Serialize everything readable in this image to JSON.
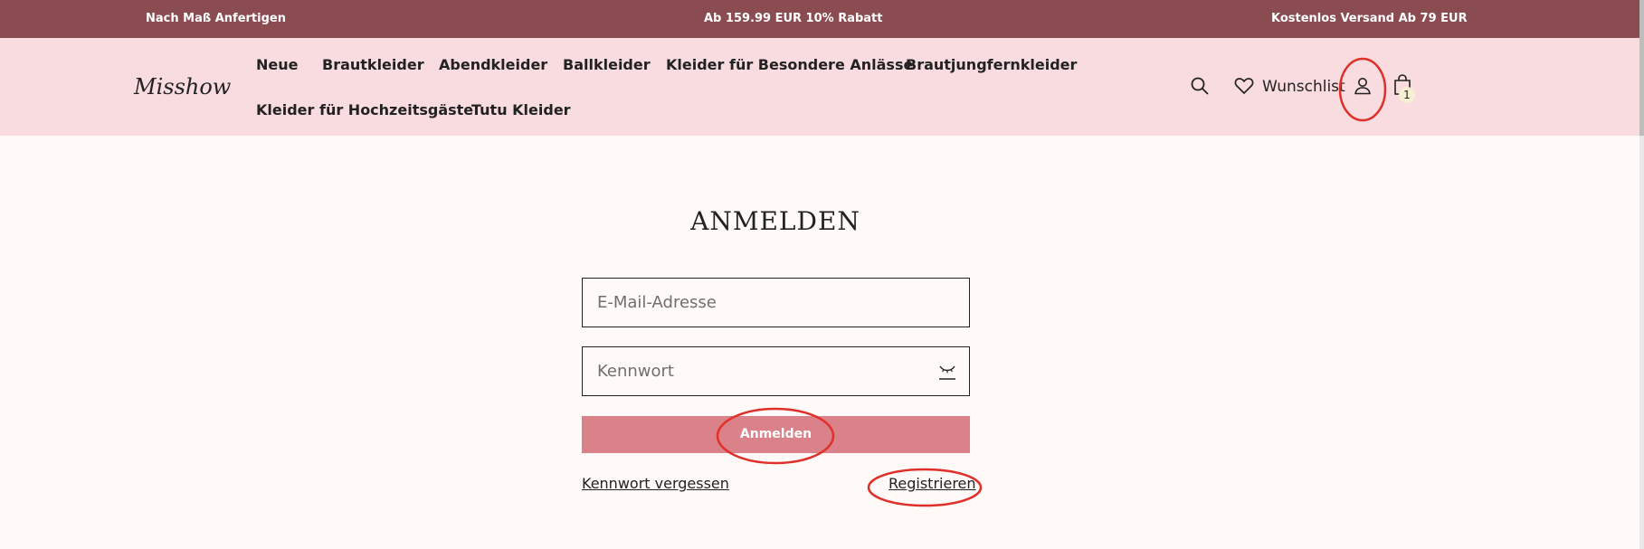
{
  "topbar": {
    "left": "Nach Maß Anfertigen",
    "center": "Ab 159.99 EUR 10% Rabatt",
    "right": "Kostenlos Versand Ab 79 EUR"
  },
  "brand": {
    "logo": "Misshow"
  },
  "nav": {
    "items": [
      "Neue",
      "Brautkleider",
      "Abendkleider",
      "Ballkleider",
      "Kleider für Besondere Anlässe",
      "Brautjungfernkleider",
      "Kleider für Hochzeitsgäste",
      "Tutu Kleider"
    ]
  },
  "header_icons": {
    "search": "search-icon",
    "wishlist_icon": "heart-icon",
    "wishlist_label": "Wunschlist",
    "account": "user-icon",
    "cart": "shopping-bag-icon",
    "cart_count": "1"
  },
  "login": {
    "title": "ANMELDEN",
    "email_placeholder": "E-Mail-Adresse",
    "password_placeholder": "Kennwort",
    "submit_label": "Anmelden",
    "forgot_label": "Kennwort vergessen",
    "register_label": "Registrieren"
  },
  "colors": {
    "topbar": "#8a4b51",
    "header": "#f9dce0",
    "button": "#db8189",
    "annotation": "#e0302a"
  }
}
